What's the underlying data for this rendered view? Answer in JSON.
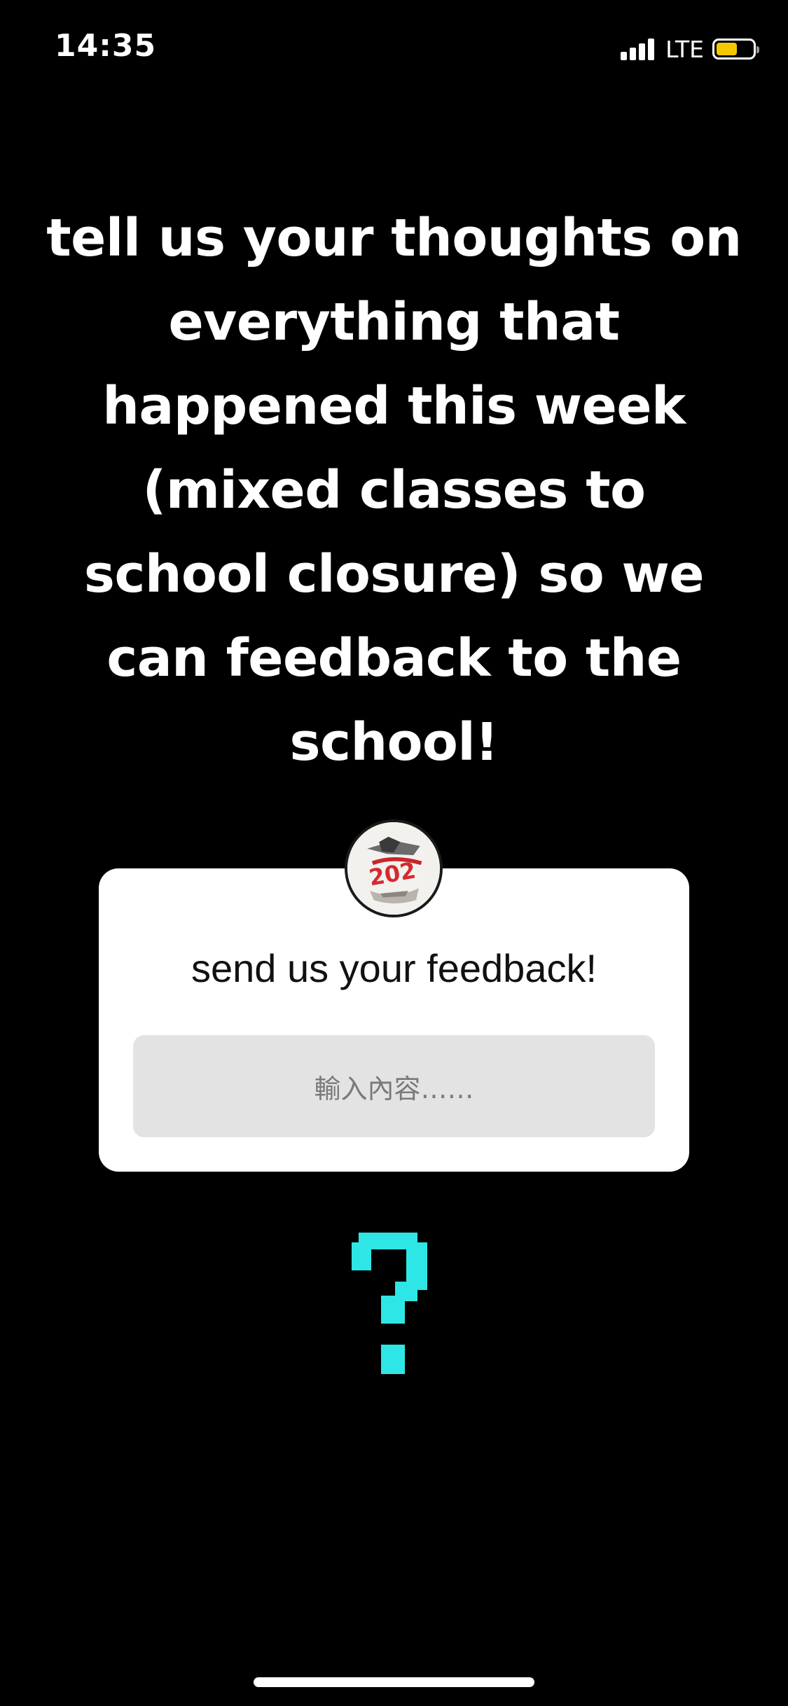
{
  "status_bar": {
    "time": "14:35",
    "network": "LTE",
    "signal_icon": "cellular-signal-icon",
    "battery_icon": "battery-icon",
    "battery_level": 0.58,
    "battery_color": "#f4c800"
  },
  "story": {
    "headline": "tell us your thoughts on everything that happened this week (mixed classes to school closure) so we can feedback to the school!",
    "background_color": "#000000",
    "text_color": "#ffffff"
  },
  "question_sticker": {
    "avatar_icon": "profile-avatar-icon",
    "prompt": "send us your feedback!",
    "input_placeholder": "輸入內容……",
    "card_color": "#ffffff",
    "input_color": "#e3e3e3"
  },
  "decoration": {
    "icon": "question-mark-icon",
    "color": "#2ee6e6"
  }
}
